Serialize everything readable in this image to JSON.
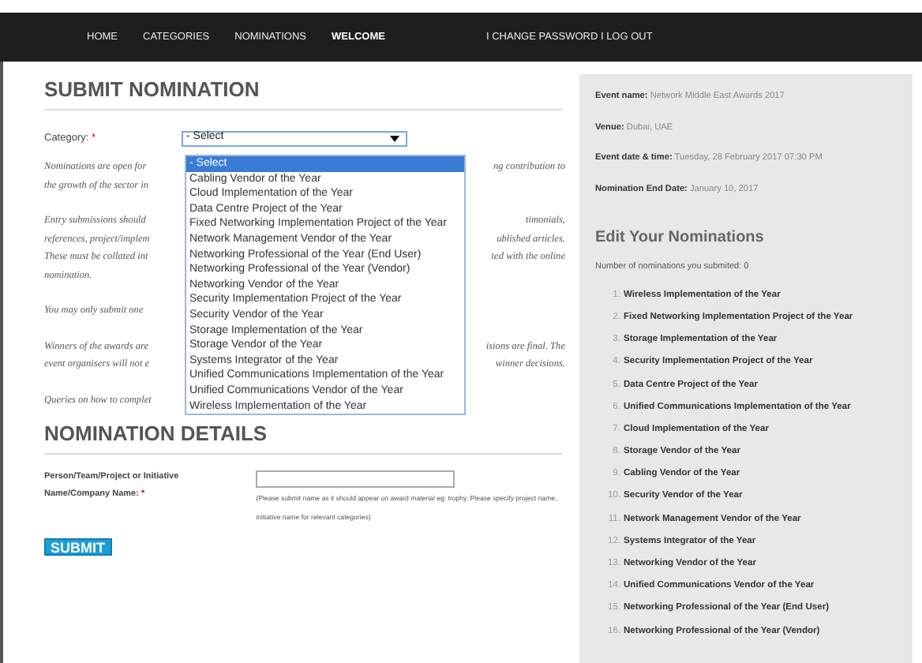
{
  "nav": [
    {
      "label": "HOME",
      "kind": "link"
    },
    {
      "label": "CATEGORIES",
      "kind": "link"
    },
    {
      "label": "NOMINATIONS",
      "kind": "link"
    },
    {
      "label": "WELCOME",
      "kind": "greeting"
    },
    {
      "label": "I CHANGE PASSWORD I LOG OUT",
      "kind": "link"
    }
  ],
  "submit_section": {
    "title": "SUBMIT NOMINATION",
    "category_label": "Category:",
    "required_mark": "*",
    "select": {
      "value": "- Select",
      "options": [
        {
          "label": "- Select",
          "selected": true
        },
        {
          "label": "Cabling Vendor of the Year",
          "selected": false
        },
        {
          "label": "Cloud Implementation of the Year",
          "selected": false
        },
        {
          "label": "Data Centre Project of the Year",
          "selected": false
        },
        {
          "label": "Fixed Networking Implementation Project of the Year",
          "selected": false
        },
        {
          "label": "Network Management Vendor of the Year",
          "selected": false
        },
        {
          "label": "Networking Professional of the Year (End User)",
          "selected": false
        },
        {
          "label": "Networking Professional of the Year (Vendor)",
          "selected": false
        },
        {
          "label": "Networking Vendor of the Year",
          "selected": false
        },
        {
          "label": "Security Implementation Project of the Year",
          "selected": false
        },
        {
          "label": "Security Vendor of the Year",
          "selected": false
        },
        {
          "label": "Storage Implementation of the Year",
          "selected": false
        },
        {
          "label": "Storage Vendor of the Year",
          "selected": false
        },
        {
          "label": "Systems Integrator of the Year",
          "selected": false
        },
        {
          "label": "Unified Communications Implementation of the Year",
          "selected": false
        },
        {
          "label": "Unified Communications Vendor of the Year",
          "selected": false
        },
        {
          "label": "Wireless Implementation of the Year",
          "selected": false
        }
      ]
    },
    "paragraphs": [
      [
        {
          "left": "Nominations are open for",
          "right": "ng contribution to"
        },
        {
          "left": "the growth of the sector in"
        }
      ],
      [
        {
          "left": "Entry submissions should",
          "right": "timonials,"
        },
        {
          "left": "references, project/implem",
          "right": "ublished articles."
        },
        {
          "left": "These must be collated int",
          "right": "ted with the online"
        },
        {
          "left": "nomination."
        }
      ],
      [
        {
          "left": "You may only submit one"
        }
      ],
      [
        {
          "left": "Winners of the awards are",
          "right": "isions are final. The"
        },
        {
          "left": "event organisers will not e",
          "right": "winner decisions."
        }
      ],
      [
        {
          "left": "Queries on how to complet"
        }
      ]
    ]
  },
  "details_section": {
    "title": "NOMINATION DETAILS",
    "name_label": [
      "Person/Team/Project or Initiative",
      "Name/Company Name:"
    ],
    "required_mark": "*",
    "hint": "(Please submit name as it should appear on award material eg: trophy. Please specify project name, initiative name for relevant categories)",
    "submit": "SUBMIT"
  },
  "sidebar": {
    "event_info": [
      {
        "label": "Event name:",
        "value": "Network Middle East Awards 2017"
      },
      {
        "label": "Venue:",
        "value": "Dubai, UAE"
      },
      {
        "label": "Event date & time:",
        "value": "Tuesday, 28 February 2017 07:30 PM"
      },
      {
        "label": "Nomination End Date:",
        "value": "January 10, 2017"
      }
    ],
    "heading": "Edit Your Nominations",
    "count_label": "Number of nominations you submited:",
    "count": "0",
    "nominations": [
      {
        "number": "1.",
        "label": "Wireless Implementation of the Year"
      },
      {
        "number": "2.",
        "label": "Fixed Networking Implementation Project of the Year"
      },
      {
        "number": "3.",
        "label": "Storage Implementation of the Year"
      },
      {
        "number": "4.",
        "label": "Security Implementation Project of the Year"
      },
      {
        "number": "5.",
        "label": "Data Centre Project of the Year"
      },
      {
        "number": "6.",
        "label": "Unified Communications Implementation of the Year"
      },
      {
        "number": "7.",
        "label": "Cloud Implementation of the Year"
      },
      {
        "number": "8.",
        "label": "Storage Vendor of the Year"
      },
      {
        "number": "9.",
        "label": "Cabling Vendor of the Year"
      },
      {
        "number": "10.",
        "label": "Security Vendor of the Year"
      },
      {
        "number": "11.",
        "label": "Network Management Vendor of the Year"
      },
      {
        "number": "12.",
        "label": "Systems Integrator of the Year"
      },
      {
        "number": "13.",
        "label": "Networking Vendor of the Year"
      },
      {
        "number": "14.",
        "label": "Unified Communications Vendor of the Year"
      },
      {
        "number": "15.",
        "label": "Networking Professional of the Year (End User)"
      },
      {
        "number": "16.",
        "label": "Networking Professional of the Year (Vendor)"
      }
    ]
  }
}
